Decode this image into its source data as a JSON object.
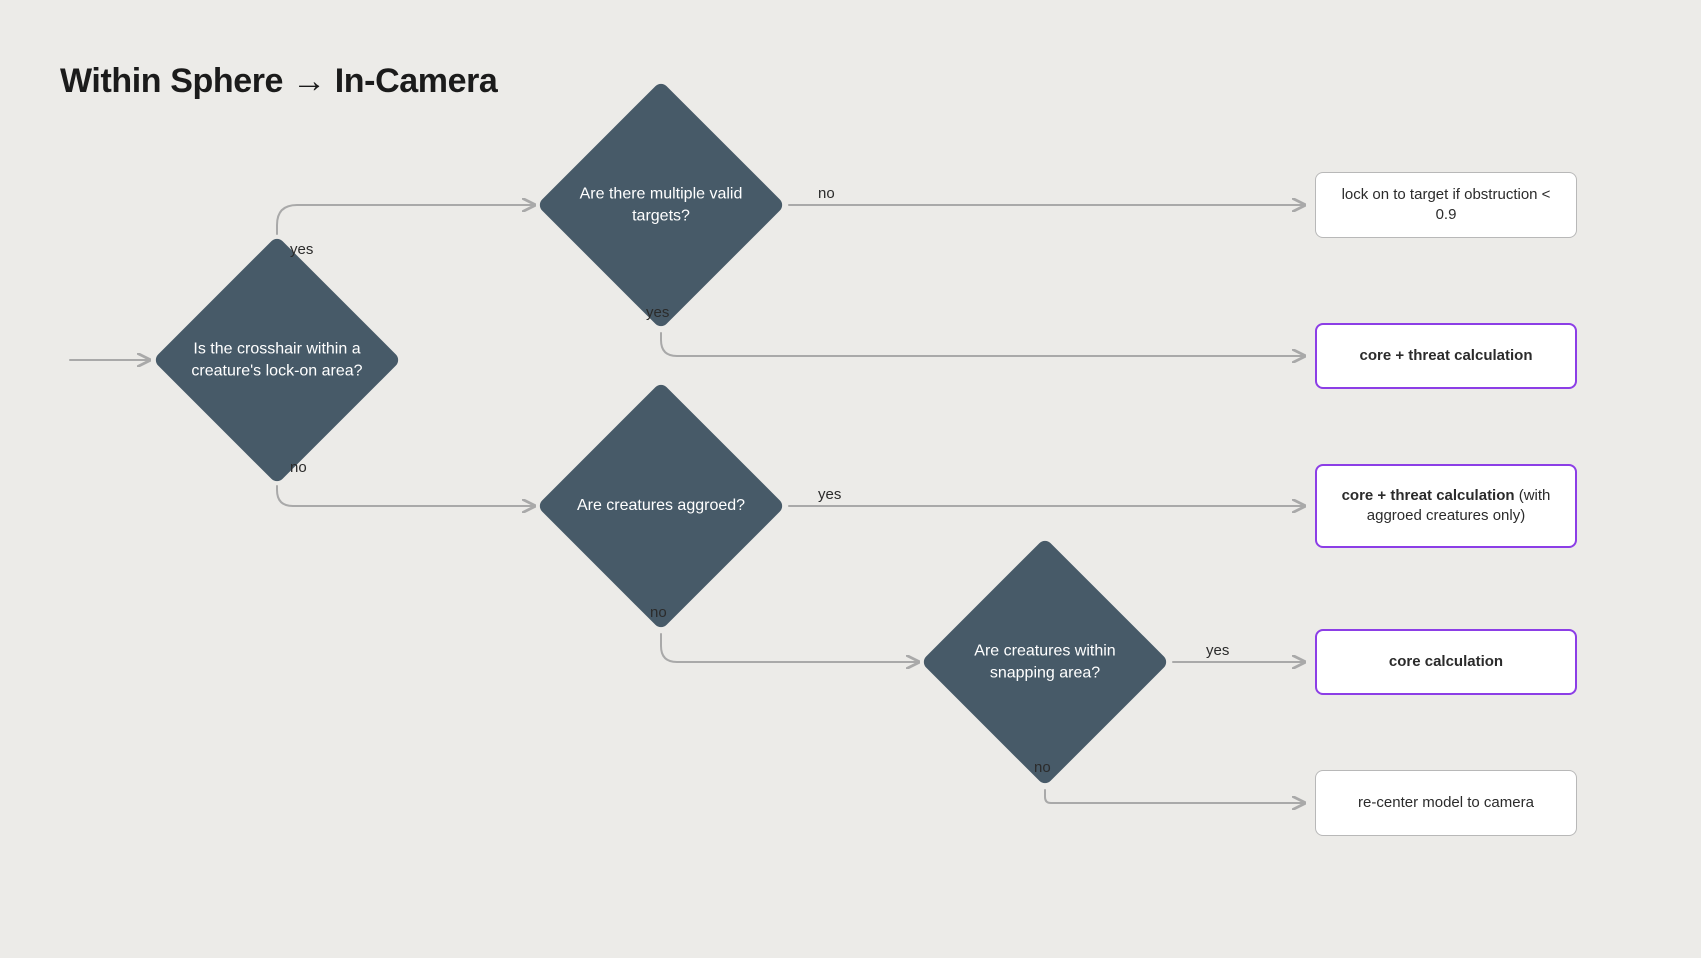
{
  "title": "Within Sphere → In-Camera",
  "labels": {
    "yes": "yes",
    "no": "no"
  },
  "decisions": {
    "d1": "Is the crosshair within a creature's lock-on area?",
    "d2": "Are there multiple valid targets?",
    "d3": "Are creatures aggroed?",
    "d4": "Are creatures within snapping area?"
  },
  "boxes": {
    "b1": "lock on to target if obstruction < 0.9",
    "b2_bold": "core + threat calculation",
    "b3_bold": "core + threat calculation",
    "b3_tail": " (with aggroed creatures only)",
    "b4_bold": "core calculation",
    "b5": "re-center model to camera"
  }
}
